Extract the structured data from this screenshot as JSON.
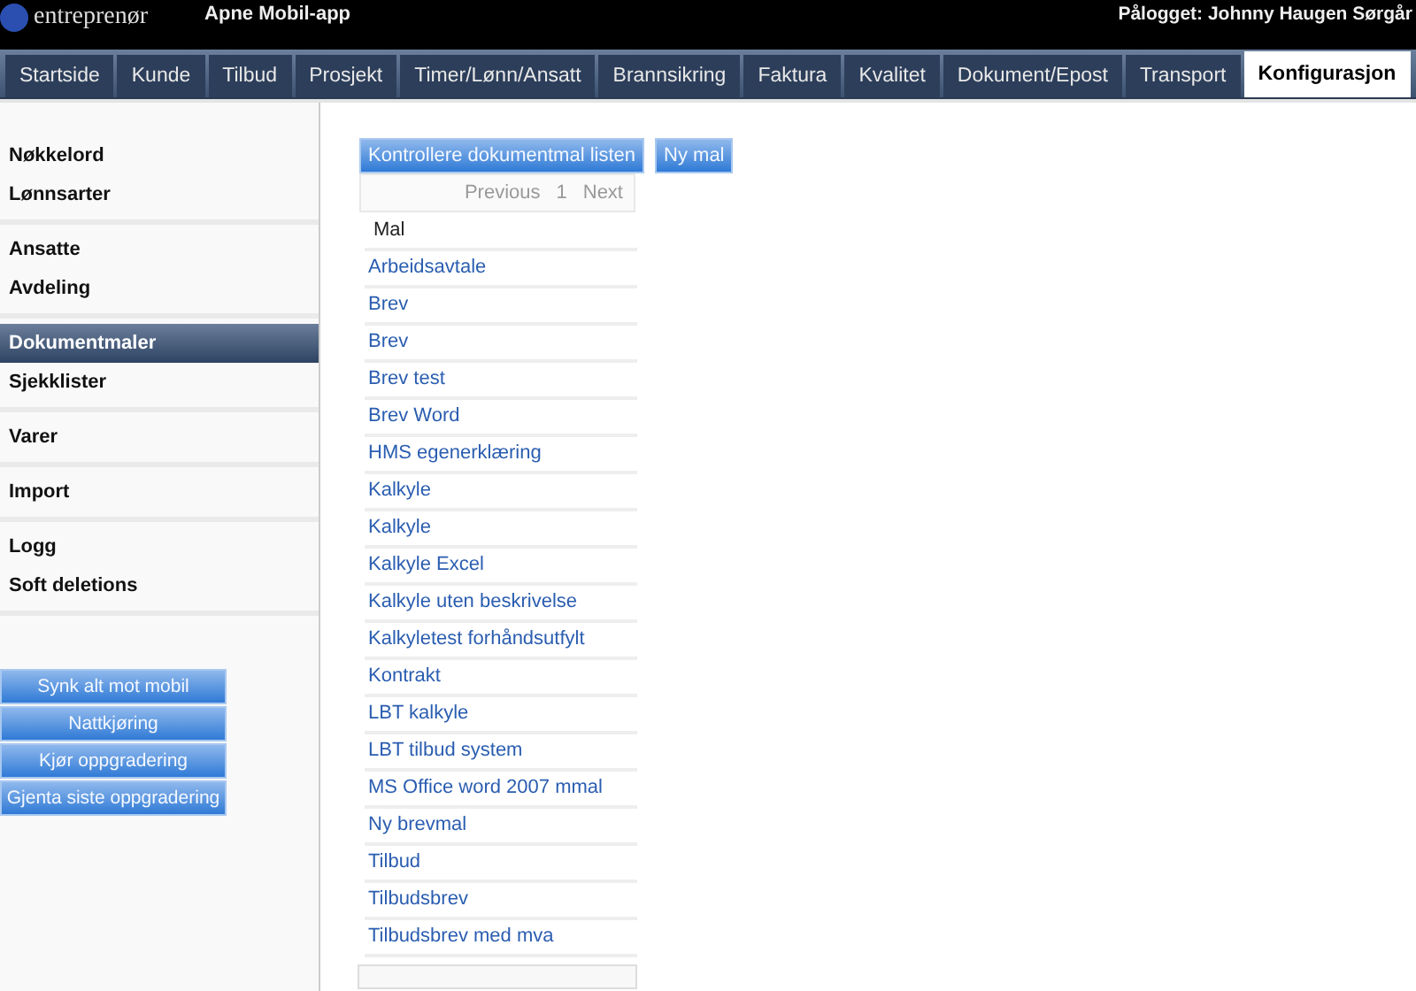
{
  "header": {
    "logo_text": "entreprenør",
    "app_link": "Apne Mobil-app",
    "user": "Pålogget: Johnny Haugen Sørgår"
  },
  "tabs": [
    {
      "label": "Startside",
      "selected": false
    },
    {
      "label": "Kunde",
      "selected": false
    },
    {
      "label": "Tilbud",
      "selected": false
    },
    {
      "label": "Prosjekt",
      "selected": false
    },
    {
      "label": "Timer/Lønn/Ansatt",
      "selected": false
    },
    {
      "label": "Brannsikring",
      "selected": false
    },
    {
      "label": "Faktura",
      "selected": false
    },
    {
      "label": "Kvalitet",
      "selected": false
    },
    {
      "label": "Dokument/Epost",
      "selected": false
    },
    {
      "label": "Transport",
      "selected": false
    },
    {
      "label": "Konfigurasjon",
      "selected": true
    }
  ],
  "sidebar": {
    "groups": [
      [
        {
          "label": "Nøkkelord",
          "selected": false
        },
        {
          "label": "Lønnsarter",
          "selected": false
        }
      ],
      [
        {
          "label": "Ansatte",
          "selected": false
        },
        {
          "label": "Avdeling",
          "selected": false
        }
      ],
      [
        {
          "label": "Dokumentmaler",
          "selected": true
        },
        {
          "label": "Sjekklister",
          "selected": false
        }
      ],
      [
        {
          "label": "Varer",
          "selected": false
        }
      ],
      [
        {
          "label": "Import",
          "selected": false
        }
      ],
      [
        {
          "label": "Logg",
          "selected": false
        },
        {
          "label": "Soft deletions",
          "selected": false
        }
      ]
    ],
    "buttons": [
      "Synk alt mot mobil",
      "Nattkjøring",
      "Kjør oppgradering",
      "Gjenta siste oppgradering"
    ]
  },
  "toolbar": {
    "buttons": [
      "Kontrollere dokumentmal listen",
      "Ny mal"
    ]
  },
  "pager": {
    "previous": "Previous",
    "page": "1",
    "next": "Next"
  },
  "table": {
    "column": "Mal",
    "rows": [
      "Arbeidsavtale",
      "Brev",
      "Brev",
      "Brev test",
      "Brev Word",
      "HMS egenerklæring",
      "Kalkyle",
      "Kalkyle",
      "Kalkyle Excel",
      "Kalkyle uten beskrivelse",
      "Kalkyletest forhåndsutfylt",
      "Kontrakt",
      "LBT kalkyle",
      "LBT tilbud system",
      "MS Office word 2007 mmal",
      "Ny brevmal",
      "Tilbud",
      "Tilbudsbrev",
      "Tilbudsbrev med mva"
    ]
  }
}
